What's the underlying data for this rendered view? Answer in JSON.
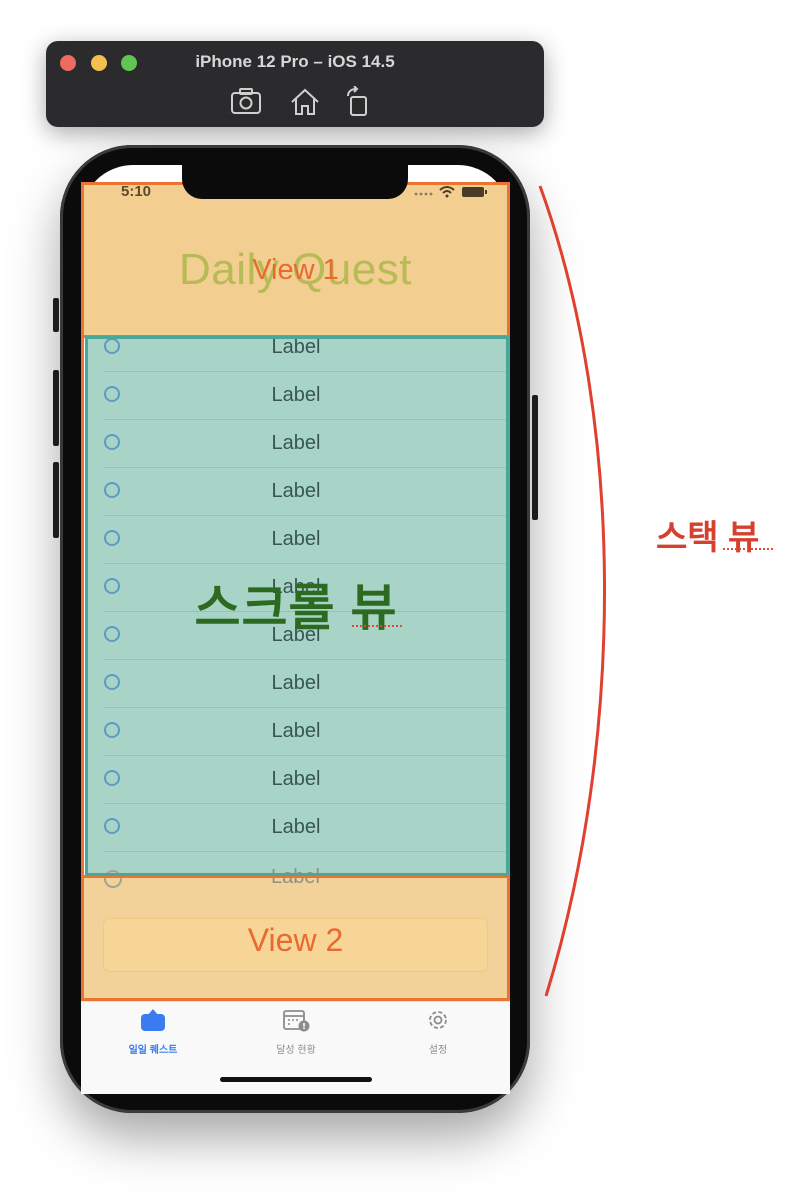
{
  "simulator": {
    "title": "iPhone 12 Pro – iOS 14.5",
    "toolbar_icons": [
      "screenshot-icon",
      "home-icon",
      "rotate-icon"
    ]
  },
  "status_bar": {
    "time": "5:10"
  },
  "view1": {
    "title": "Daily Quest",
    "overlay_label": "View 1"
  },
  "scroll": {
    "overlay_label": "스크롤 뷰",
    "rows": [
      {
        "label": "Label"
      },
      {
        "label": "Label"
      },
      {
        "label": "Label"
      },
      {
        "label": "Label"
      },
      {
        "label": "Label"
      },
      {
        "label": "Label"
      },
      {
        "label": "Label"
      },
      {
        "label": "Label"
      },
      {
        "label": "Label"
      },
      {
        "label": "Label"
      },
      {
        "label": "Label"
      },
      {
        "label": "Label"
      }
    ]
  },
  "view2": {
    "overlay_label": "View 2"
  },
  "tabbar": {
    "tabs": [
      {
        "label": "일일 퀘스트",
        "icon": "quest-icon",
        "active": true
      },
      {
        "label": "달성 현황",
        "icon": "calendar-icon",
        "active": false
      },
      {
        "label": "설정",
        "icon": "gear-icon",
        "active": false
      }
    ]
  },
  "annotation": {
    "stack_label": "스택 뷰"
  },
  "colors": {
    "view_orange": "#f3ce91",
    "scroll_teal": "#a7d4c6",
    "frame_orange": "#ec7433",
    "frame_teal": "#4aa79a",
    "annotation_red": "#d6412e",
    "tab_active_blue": "#3a7cf0"
  }
}
